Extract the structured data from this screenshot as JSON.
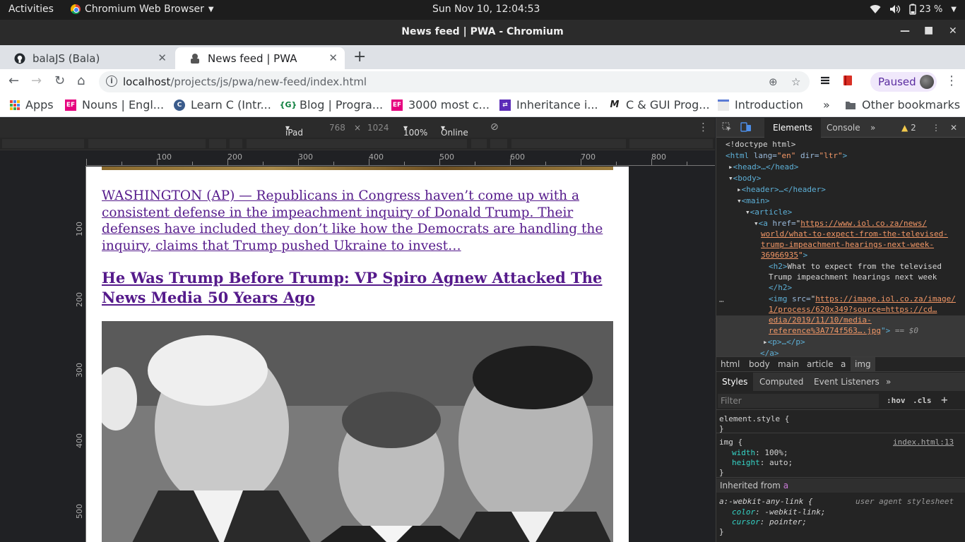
{
  "system": {
    "activities": "Activities",
    "app_name": "Chromium Web Browser",
    "clock": "Sun Nov 10, 12:04:53",
    "battery": "23 %"
  },
  "window": {
    "title": "News feed | PWA - Chromium"
  },
  "tabs": [
    {
      "label": "balaJS (Bala)"
    },
    {
      "label": "News feed | PWA"
    }
  ],
  "toolbar": {
    "url_host": "localhost",
    "url_path": "/projects/js/pwa/new-feed/index.html",
    "profile_label": "Paused"
  },
  "bookmarks": {
    "items": [
      {
        "label": "Apps"
      },
      {
        "label": "Nouns | Engl..."
      },
      {
        "label": "Learn C (Intr..."
      },
      {
        "label": "Blog | Progra..."
      },
      {
        "label": "3000 most c..."
      },
      {
        "label": "Inheritance i..."
      },
      {
        "label": "C & GUI Prog..."
      },
      {
        "label": "Introduction"
      }
    ],
    "overflow": "»",
    "other": "Other bookmarks"
  },
  "device_toolbar": {
    "device": "iPad",
    "width": "768",
    "times": "×",
    "height": "1024",
    "zoom": "100%",
    "network": "Online"
  },
  "ruler": {
    "h_labels": [
      "100",
      "200",
      "300",
      "400",
      "500",
      "600",
      "700",
      "800"
    ],
    "v_labels": [
      "100",
      "200",
      "300",
      "400",
      "500"
    ]
  },
  "page": {
    "paragraph": "WASHINGTON (AP) — Republicans in Congress haven’t come up with a consistent defense in the impeachment inquiry of Donald Trump. Their defenses have included they don’t like how the Democrats are handling the inquiry, claims that Trump pushed Ukraine to invest…",
    "headline": "He Was Trump Before Trump: VP Spiro Agnew Attacked The News Media 50 Years Ago"
  },
  "devtools": {
    "tabs": {
      "elements": "Elements",
      "console": "Console",
      "more": "»",
      "warnings": "2"
    },
    "dom": {
      "doctype": "<!doctype html>",
      "html_open": "<html",
      "html_lang_attr": "lang=",
      "html_lang_val": "\"en\"",
      "html_dir_attr": "dir=",
      "html_dir_val": "\"ltr\"",
      "html_close": ">",
      "head": "<head>…</head>",
      "body": "<body>",
      "header": "<header>…</header>",
      "main": "<main>",
      "article": "<article>",
      "a_open": "<a",
      "href_attr": "href=",
      "href_val_1": "https://www.iol.co.za/news/",
      "href_val_2": "world/what-to-expect-from-the-televised-",
      "href_val_3": "trump-impeachment-hearings-next-week-",
      "href_val_4": "36966935",
      "h2_open": "<h2>",
      "h2_text_1": "What to expect from the televised",
      "h2_text_2": "Trump impeachment hearings next week",
      "h2_close": "</h2>",
      "img_open": "<img",
      "src_attr": "src=",
      "src_val_1": "https://image.iol.co.za/image/",
      "src_val_2": "1/process/620x349?source=https://cd…",
      "src_val_3": "edia/2019/11/10/media-",
      "src_val_4": "reference%3A774f563….jpg",
      "img_close": "\">",
      "eq": "== $0",
      "p": "<p>…</p>",
      "a_close": "</a>",
      "dots": "…"
    },
    "breadcrumbs": [
      "html",
      "body",
      "main",
      "article",
      "a",
      "img"
    ],
    "style_tabs": [
      "Styles",
      "Computed",
      "Event Listeners",
      "»"
    ],
    "filter_placeholder": "Filter",
    "hov": ":hov",
    "cls": ".cls",
    "plus": "+",
    "styles": {
      "element_style": "element.style {",
      "close": "}",
      "img_selector": "img {",
      "img_source": "index.html:13",
      "width_prop": "width",
      "width_val": ": 100%;",
      "height_prop": "height",
      "height_val": ": auto;",
      "inherited_label": "Inherited from",
      "inherited_tag": "a",
      "ua_selector": "a:-webkit-any-link {",
      "ua_source": "user agent stylesheet",
      "color_prop": "color",
      "color_val": ": -webkit-link;",
      "cursor_prop": "cursor",
      "cursor_val": ": pointer;"
    }
  }
}
